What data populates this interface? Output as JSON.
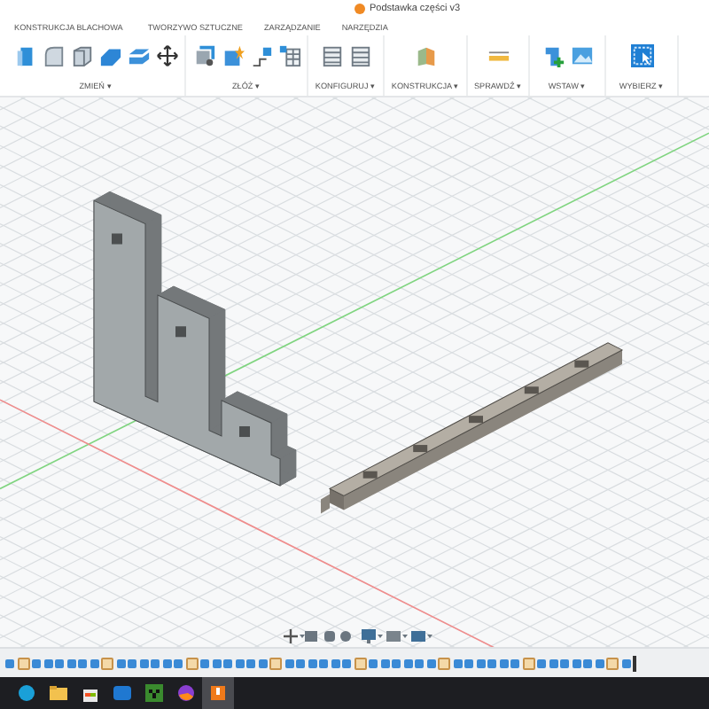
{
  "window": {
    "title": "Podstawka części v3"
  },
  "workspace_tabs": [
    {
      "label": "KONSTRUKCJA BLACHOWA"
    },
    {
      "label": "TWORZYWO SZTUCZNE"
    },
    {
      "label": "ZARZĄDZANIE"
    },
    {
      "label": "NARZĘDZIA"
    }
  ],
  "panels": [
    {
      "menu": "ZMIEŃ ▾"
    },
    {
      "menu": "ZŁÓŻ ▾"
    },
    {
      "menu": "KONFIGURUJ ▾"
    },
    {
      "menu": "KONSTRUKCJA ▾"
    },
    {
      "menu": "SPRAWDŹ ▾"
    },
    {
      "menu": "WSTAW ▾"
    },
    {
      "menu": "WYBIERZ ▾"
    }
  ]
}
